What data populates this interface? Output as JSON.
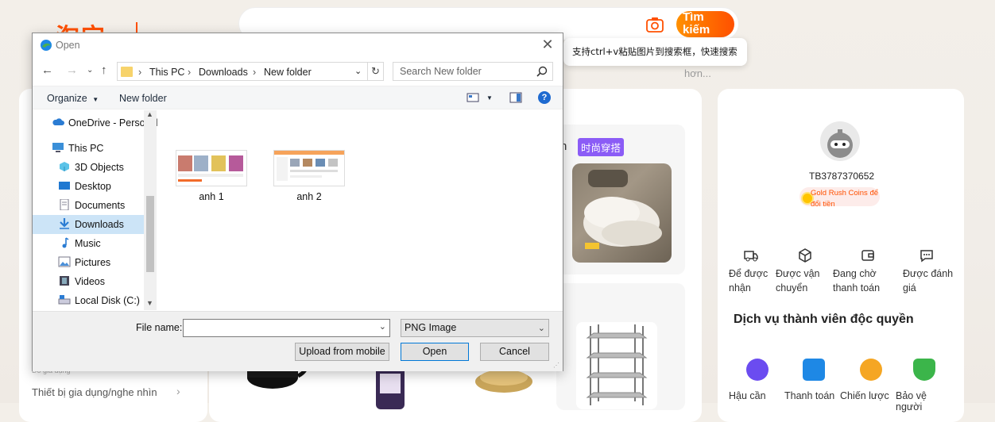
{
  "bg": {
    "logo": "淘宝",
    "search_button": "Tìm kiếm",
    "tooltip": "支持ctrl+v粘贴图片到搜索框，快速搜索",
    "more": "hơn...",
    "category_item": "Thiết bị gia dụng/nghe nhìn",
    "category_small": "Đồ gia dụng",
    "section_char": "n",
    "section_tag": "时尚穿搭",
    "user": {
      "name": "TB3787370652",
      "coins": "Gold Rush Coins để đổi tiền"
    },
    "orders": [
      {
        "label": "Để được nhận",
        "icon": "truck-icon"
      },
      {
        "label": "Được vận chuyển",
        "icon": "box-icon"
      },
      {
        "label": "Đang chờ thanh toán",
        "icon": "wallet-icon"
      },
      {
        "label": "Được đánh giá",
        "icon": "chat-icon"
      }
    ],
    "member_title": "Dịch vụ thành viên độc quyền",
    "services": [
      {
        "label": "Hậu cần",
        "icon": "delivery-icon",
        "color": "#6b4cf0"
      },
      {
        "label": "Thanh toán",
        "icon": "card-icon",
        "color": "#1e88e5"
      },
      {
        "label": "Chiến lược",
        "icon": "compass-icon",
        "color": "#f5a623"
      },
      {
        "label": "Bảo vệ người",
        "icon": "shield-icon",
        "color": "#3bb54a"
      }
    ],
    "colors": {
      "accent": "#ff5000",
      "tag": "#8b5cf6"
    }
  },
  "dialog": {
    "title": "Open",
    "breadcrumb": [
      "This PC",
      "Downloads",
      "New folder"
    ],
    "search_placeholder": "Search New folder",
    "toolbar": {
      "organize": "Organize",
      "new_folder": "New folder"
    },
    "nav": [
      {
        "label": "OneDrive - Personal",
        "icon": "cloud-icon"
      },
      {
        "label": "This PC",
        "icon": "computer-icon"
      },
      {
        "label": "3D Objects",
        "icon": "cube-icon"
      },
      {
        "label": "Desktop",
        "icon": "desktop-icon"
      },
      {
        "label": "Documents",
        "icon": "document-icon"
      },
      {
        "label": "Downloads",
        "icon": "download-icon",
        "selected": true
      },
      {
        "label": "Music",
        "icon": "music-icon"
      },
      {
        "label": "Pictures",
        "icon": "picture-icon"
      },
      {
        "label": "Videos",
        "icon": "video-icon"
      },
      {
        "label": "Local Disk (C:)",
        "icon": "disk-icon"
      }
    ],
    "files": [
      {
        "name": "anh 1"
      },
      {
        "name": "anh 2"
      }
    ],
    "file_name_label": "File name:",
    "file_name_value": "",
    "file_type": "PNG Image",
    "buttons": {
      "upload": "Upload from mobile",
      "open": "Open",
      "cancel": "Cancel"
    }
  }
}
